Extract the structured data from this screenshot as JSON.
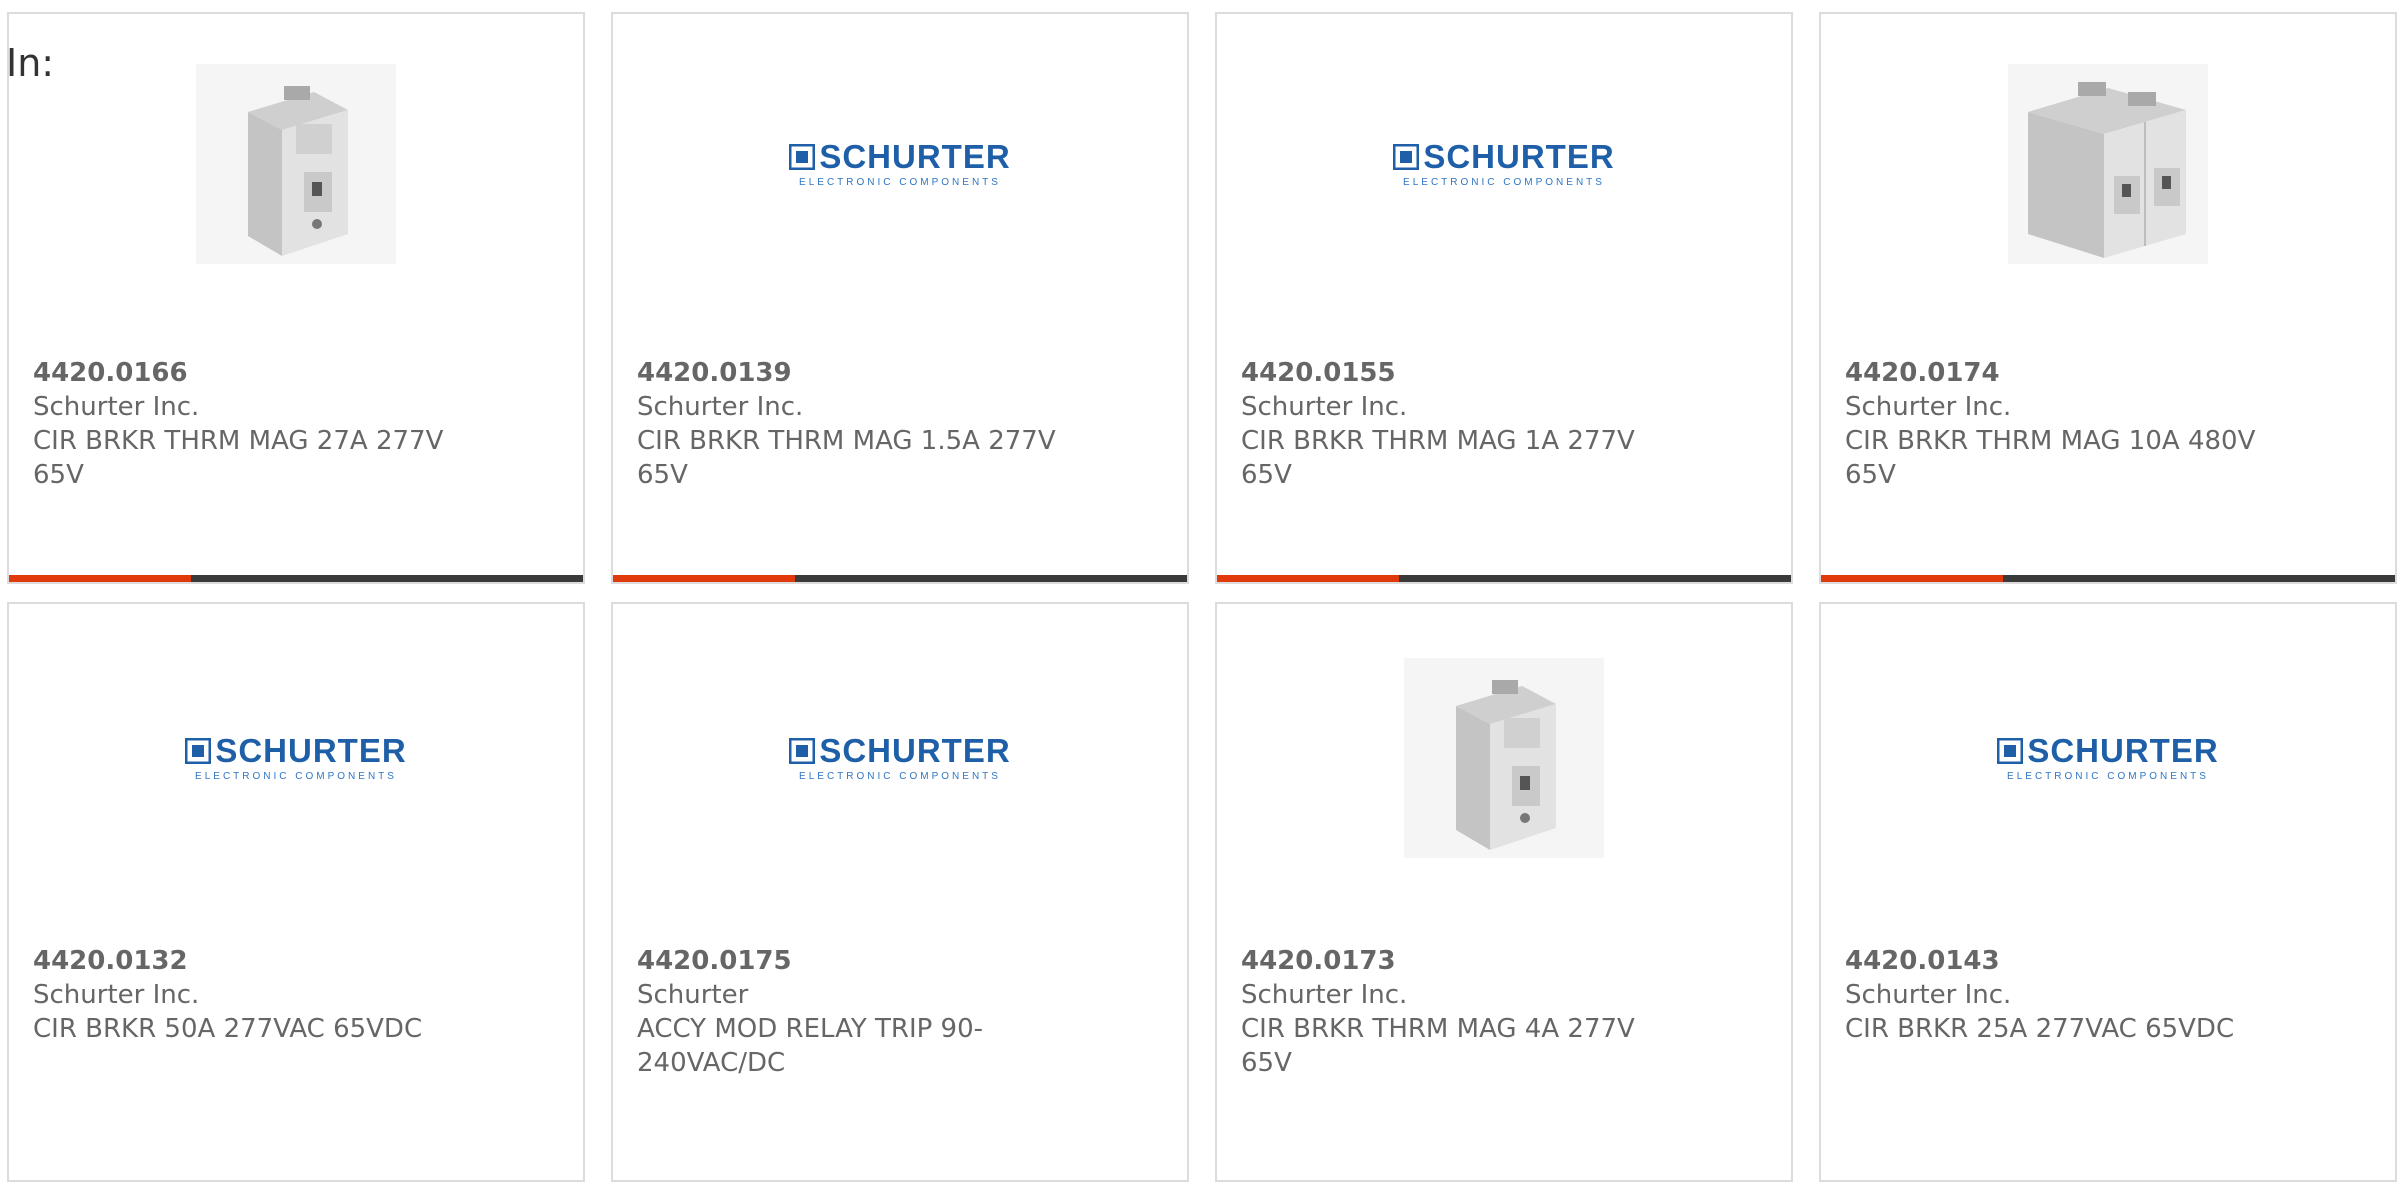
{
  "header": {
    "in_label": "In:"
  },
  "colors": {
    "accent": "#e03a0c",
    "bar": "#3a3a3a",
    "logo": "#1f5fa8"
  },
  "products": [
    {
      "part_number": "4420.0166",
      "manufacturer": "Schurter Inc.",
      "description": "CIR BRKR THRM MAG 27A 277V 65V",
      "image": "breaker-1-pole-photo"
    },
    {
      "part_number": "4420.0139",
      "manufacturer": "Schurter Inc.",
      "description": "CIR BRKR THRM MAG 1.5A 277V 65V",
      "image": "schurter-logo"
    },
    {
      "part_number": "4420.0155",
      "manufacturer": "Schurter Inc.",
      "description": "CIR BRKR THRM MAG 1A 277V 65V",
      "image": "schurter-logo"
    },
    {
      "part_number": "4420.0174",
      "manufacturer": "Schurter Inc.",
      "description": "CIR BRKR THRM MAG 10A 480V 65V",
      "image": "breaker-2-pole-photo"
    },
    {
      "part_number": "4420.0132",
      "manufacturer": "Schurter Inc.",
      "description": "CIR BRKR 50A 277VAC 65VDC",
      "image": "schurter-logo"
    },
    {
      "part_number": "4420.0175",
      "manufacturer": "Schurter",
      "description": "ACCY MOD RELAY TRIP 90-240VAC/DC",
      "image": "schurter-logo"
    },
    {
      "part_number": "4420.0173",
      "manufacturer": "Schurter Inc.",
      "description": "CIR BRKR THRM MAG 4A 277V 65V",
      "image": "breaker-1-pole-photo"
    },
    {
      "part_number": "4420.0143",
      "manufacturer": "Schurter Inc.",
      "description": "CIR BRKR 25A 277VAC 65VDC",
      "image": "schurter-logo"
    }
  ],
  "logo": {
    "word": "SCHURTER",
    "tagline": "ELECTRONIC COMPONENTS"
  }
}
